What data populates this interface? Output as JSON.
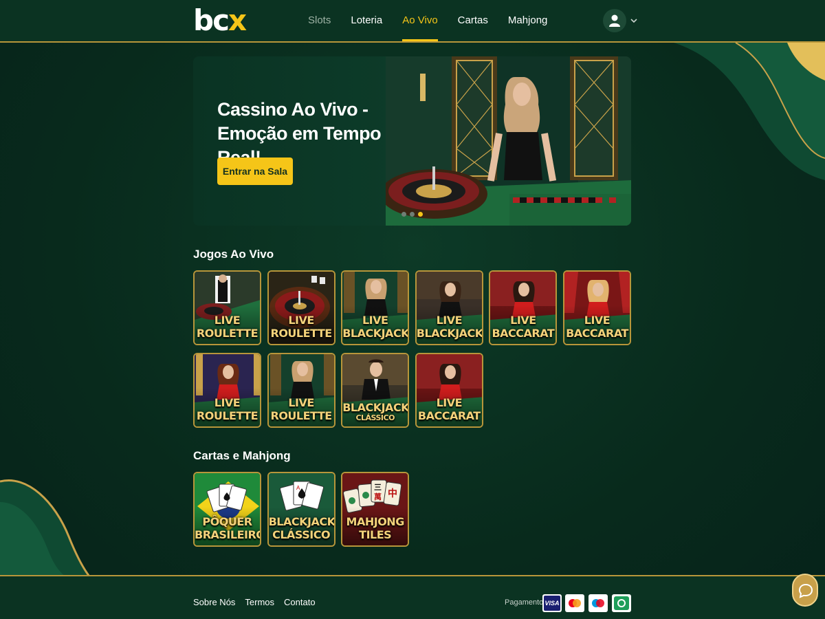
{
  "header": {
    "logo": {
      "main": "bc",
      "accent": "x"
    },
    "nav": [
      {
        "label": "Slots",
        "state": "muted"
      },
      {
        "label": "Loteria",
        "state": "normal"
      },
      {
        "label": "Ao Vivo",
        "state": "active"
      },
      {
        "label": "Cartas",
        "state": "normal"
      },
      {
        "label": "Mahjong",
        "state": "normal"
      }
    ]
  },
  "hero": {
    "title_line1": "Cassino Ao Vivo -",
    "title_line2": "Emoção em Tempo Real!",
    "button": "Entrar na Sala",
    "slide_count": 3,
    "active_slide": 3
  },
  "live_section": {
    "title": "Jogos Ao Vivo",
    "games": [
      {
        "line1": "LIVE",
        "line2": "ROULETTE",
        "scene": "roulette-dealer"
      },
      {
        "line1": "LIVE",
        "line2": "ROULETTE",
        "scene": "roulette-wheel"
      },
      {
        "line1": "LIVE",
        "line2": "BLACKJACK",
        "scene": "dealer-green"
      },
      {
        "line1": "LIVE",
        "line2": "BLACKJACK",
        "scene": "dealer-dark"
      },
      {
        "line1": "LIVE",
        "line2": "BACCARAT",
        "scene": "dealer-red"
      },
      {
        "line1": "LIVE",
        "line2": "BACCARAT",
        "scene": "dealer-red-curtain"
      },
      {
        "line1": "LIVE",
        "line2": "ROULETTE",
        "scene": "dealer-purple"
      },
      {
        "line1": "LIVE",
        "line2": "ROULETTE",
        "scene": "dealer-green"
      },
      {
        "line1": "BLACKJACK",
        "line2": "CLÁSSICO",
        "scene": "dealer-male"
      },
      {
        "line1": "LIVE",
        "line2": "BACCARAT",
        "scene": "dealer-red"
      }
    ]
  },
  "cards_section": {
    "title": "Cartas e Mahjong",
    "games": [
      {
        "line1": "PÔQUER",
        "line2": "BRASILEIRO",
        "scene": "brazil-cards"
      },
      {
        "line1": "BLACKJACK",
        "line2": "CLÁSSICO",
        "scene": "green-cards"
      },
      {
        "line1": "MAHJONG",
        "line2": "TILES",
        "scene": "mahjong"
      }
    ]
  },
  "footer": {
    "links": [
      "Sobre Nós",
      "Termos",
      "Contato"
    ],
    "payment_label": "Pagamento",
    "payment_methods": [
      {
        "name": "VISA",
        "color": "#1a1f71"
      },
      {
        "name": "mastercard",
        "color": "#ffffff"
      },
      {
        "name": "maestro",
        "color": "#ffffff"
      },
      {
        "name": "pix",
        "color": "#32bcad"
      }
    ]
  },
  "colors": {
    "accent": "#f5c518",
    "gold_border": "#b8963a",
    "background": "#082a1c"
  }
}
